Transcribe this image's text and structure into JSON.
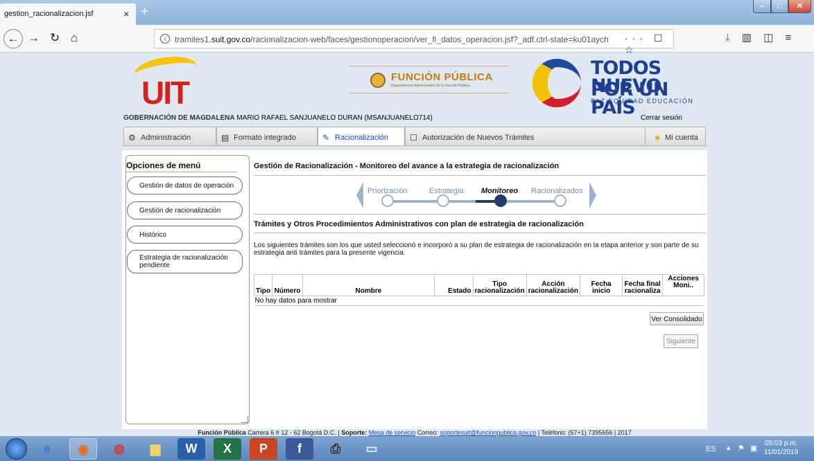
{
  "browser": {
    "tab_title": "gestion_racionalizacion.jsf",
    "tab_close": "×",
    "new_tab": "+",
    "url_prefix": "tramites1.",
    "url_domain": "suit.gov.co",
    "url_path": "/racionalizacion-web/faces/gestionoperacion/ver_fi_datos_operacion.jsf?_adf.ctrl-state=ku01aych",
    "url_tools": "··· ☐ ☆"
  },
  "banner": {
    "suit": "UIT",
    "funcion_publica": "FUNCIÓN PÚBLICA",
    "funcion_publica_sub": "Departamento Administrativo de la Función Pública",
    "tpn_line1": "TODOS POR UN",
    "tpn_line2": "NUEVO PAÍS",
    "tpn_line3": "PAZ  EQUIDAD  EDUCACIÓN"
  },
  "userbar": {
    "org": "GOBERNACIÓN DE MAGDALENA",
    "user": " MARIO RAFAEL SANJUANELO DURAN (MSANJUANELO714)",
    "logout": "Cerrar sesión"
  },
  "tabs": {
    "admin": "Administración",
    "formato": "Formato integrado",
    "racionalizacion": "Racionalización",
    "autorizacion": "Autorización de Nuevos Trámites",
    "cuenta": "Mi cuenta"
  },
  "menu": {
    "header": "Opciones de menú",
    "items": [
      "Gestión de datos de operación",
      "Gestión de racionalización",
      "Histórico",
      "Estrategia de racionalización pendiente"
    ]
  },
  "main": {
    "title": "Gestión de Racionalización - Monitoreo del avance a la estrategia de racionalización",
    "steps": [
      "Priorización",
      "Estrategia",
      "Monitoreo",
      "Racionalizados"
    ],
    "subtitle": "Trámites y Otros Procedimientos Administrativos con plan de estrategia de racionalización",
    "description": "Los siguientes trámites son los que usted seleccionó e incorporó a su plan de estrategia de racionalización en la etapa anterior y son parte de su estrategia anti trámites para la presente vigencia.",
    "columns": {
      "tipo": "Tipo",
      "numero": "Número",
      "nombre": "Nombre",
      "estado": "Estado",
      "tipo_racio_1": "Tipo",
      "tipo_racio_2": "racionalización",
      "accion_1": "Acción",
      "accion_2": "racionalización",
      "fecha_inicio": "Fecha inicio",
      "fecha_final_1": "Fecha final",
      "fecha_final_2": "racionaliza",
      "acciones_1": "Acciones",
      "acciones_2": "Moni.."
    },
    "empty": "No hay datos para mostrar",
    "btn_consolidado": "Ver Consolidado",
    "btn_siguiente": "Siguiente"
  },
  "footer": {
    "org": "Función Pública",
    "address": " Carrera 6 # 12 - 62 Bogotá D.C. | ",
    "soporte_label": "Soporte:",
    "mesa": "Mesa de servicio",
    "correo_label": "  Correo: ",
    "correo": "soportesuit@funcionpublica.gov.co",
    "telefono": " | Teléfono: (57+1) 7395656 | 2017"
  },
  "taskbar": {
    "lang": "ES",
    "time": "05:03 p.m.",
    "date": "11/01/2019"
  }
}
